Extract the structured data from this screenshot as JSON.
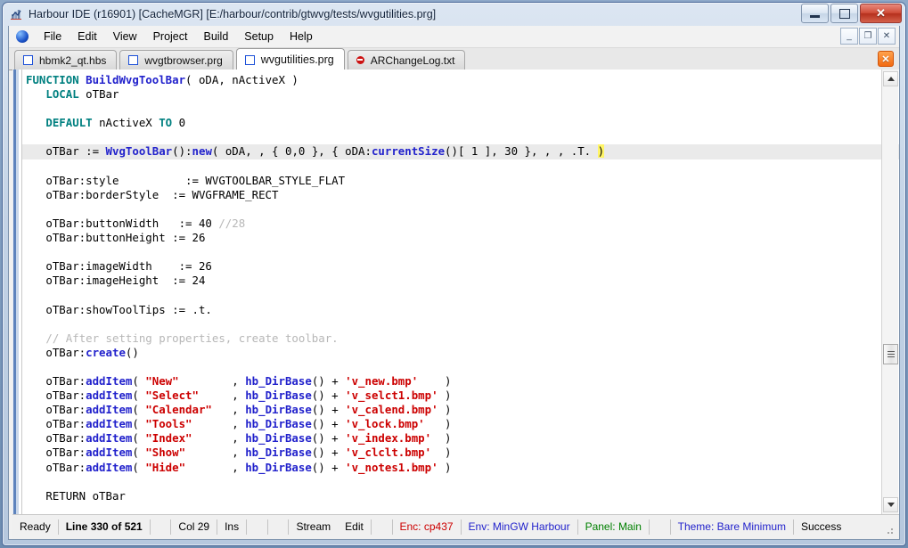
{
  "window": {
    "title": "Harbour IDE (r16901) [CacheMGR]  [E:/harbour/contrib/gtwvg/tests/wvgutilities.prg]",
    "app_icon": "chart-icon",
    "buttons": {
      "minimize": "minimize-icon",
      "maximize": "maximize-icon",
      "close": "✕"
    }
  },
  "menu": {
    "orb": "blue-orb-icon",
    "items": [
      "File",
      "Edit",
      "View",
      "Project",
      "Build",
      "Setup",
      "Help"
    ],
    "mdi_buttons": {
      "minimize": "_",
      "restore": "❐",
      "close": "✕"
    }
  },
  "tabs": {
    "items": [
      {
        "label": "hbmk2_qt.hbs",
        "icon": "file-icon",
        "active": false
      },
      {
        "label": "wvgtbrowser.prg",
        "icon": "file-icon",
        "active": false
      },
      {
        "label": "wvgutilities.prg",
        "icon": "file-icon",
        "active": true
      },
      {
        "label": "ARChangeLog.txt",
        "icon": "stop-icon",
        "active": false
      }
    ],
    "close_label": "✕"
  },
  "editor": {
    "current_line_index": 5,
    "lines": [
      [
        {
          "t": "FUNCTION ",
          "c": "k"
        },
        {
          "t": "BuildWvgToolBar",
          "c": "fn"
        },
        {
          "t": "( oDA, nActiveX )",
          "c": "t"
        }
      ],
      [
        {
          "t": "   ",
          "c": "t"
        },
        {
          "t": "LOCAL",
          "c": "k"
        },
        {
          "t": " oTBar",
          "c": "t"
        }
      ],
      [
        {
          "t": "",
          "c": "t"
        }
      ],
      [
        {
          "t": "   ",
          "c": "t"
        },
        {
          "t": "DEFAULT",
          "c": "k"
        },
        {
          "t": " nActiveX ",
          "c": "t"
        },
        {
          "t": "TO",
          "c": "k"
        },
        {
          "t": " 0",
          "c": "t"
        }
      ],
      [
        {
          "t": "",
          "c": "t"
        }
      ],
      [
        {
          "t": "   oTBar := ",
          "c": "t"
        },
        {
          "t": "WvgToolBar",
          "c": "fn"
        },
        {
          "t": "():",
          "c": "t"
        },
        {
          "t": "new",
          "c": "fn"
        },
        {
          "t": "( oDA, , { 0,0 }, { oDA:",
          "c": "t"
        },
        {
          "t": "currentSize",
          "c": "fn"
        },
        {
          "t": "()[ 1 ], 30 }, , , .T. ",
          "c": "t"
        },
        {
          "t": ")",
          "c": "brk"
        }
      ],
      [
        {
          "t": "",
          "c": "t"
        }
      ],
      [
        {
          "t": "   oTBar:style          := WVGTOOLBAR_STYLE_FLAT",
          "c": "t"
        }
      ],
      [
        {
          "t": "   oTBar:borderStyle  := WVGFRAME_RECT",
          "c": "t"
        }
      ],
      [
        {
          "t": "",
          "c": "t"
        }
      ],
      [
        {
          "t": "   oTBar:buttonWidth   := 40 ",
          "c": "t"
        },
        {
          "t": "//28",
          "c": "c"
        }
      ],
      [
        {
          "t": "   oTBar:buttonHeight := 26",
          "c": "t"
        }
      ],
      [
        {
          "t": "",
          "c": "t"
        }
      ],
      [
        {
          "t": "   oTBar:imageWidth    := 26",
          "c": "t"
        }
      ],
      [
        {
          "t": "   oTBar:imageHeight  := 24",
          "c": "t"
        }
      ],
      [
        {
          "t": "",
          "c": "t"
        }
      ],
      [
        {
          "t": "   oTBar:showToolTips := .t.",
          "c": "t"
        }
      ],
      [
        {
          "t": "",
          "c": "t"
        }
      ],
      [
        {
          "t": "   ",
          "c": "t"
        },
        {
          "t": "// After setting properties, create toolbar.",
          "c": "c"
        }
      ],
      [
        {
          "t": "   oTBar:",
          "c": "t"
        },
        {
          "t": "create",
          "c": "fn"
        },
        {
          "t": "()",
          "c": "t"
        }
      ],
      [
        {
          "t": "",
          "c": "t"
        }
      ],
      [
        {
          "t": "   oTBar:",
          "c": "t"
        },
        {
          "t": "addItem",
          "c": "fn"
        },
        {
          "t": "( ",
          "c": "t"
        },
        {
          "t": "\"New\"",
          "c": "s"
        },
        {
          "t": "        , ",
          "c": "t"
        },
        {
          "t": "hb_DirBase",
          "c": "fn"
        },
        {
          "t": "() + ",
          "c": "t"
        },
        {
          "t": "'v_new.bmp'",
          "c": "s"
        },
        {
          "t": "    )",
          "c": "t"
        }
      ],
      [
        {
          "t": "   oTBar:",
          "c": "t"
        },
        {
          "t": "addItem",
          "c": "fn"
        },
        {
          "t": "( ",
          "c": "t"
        },
        {
          "t": "\"Select\"",
          "c": "s"
        },
        {
          "t": "     , ",
          "c": "t"
        },
        {
          "t": "hb_DirBase",
          "c": "fn"
        },
        {
          "t": "() + ",
          "c": "t"
        },
        {
          "t": "'v_selct1.bmp'",
          "c": "s"
        },
        {
          "t": " )",
          "c": "t"
        }
      ],
      [
        {
          "t": "   oTBar:",
          "c": "t"
        },
        {
          "t": "addItem",
          "c": "fn"
        },
        {
          "t": "( ",
          "c": "t"
        },
        {
          "t": "\"Calendar\"",
          "c": "s"
        },
        {
          "t": "   , ",
          "c": "t"
        },
        {
          "t": "hb_DirBase",
          "c": "fn"
        },
        {
          "t": "() + ",
          "c": "t"
        },
        {
          "t": "'v_calend.bmp'",
          "c": "s"
        },
        {
          "t": " )",
          "c": "t"
        }
      ],
      [
        {
          "t": "   oTBar:",
          "c": "t"
        },
        {
          "t": "addItem",
          "c": "fn"
        },
        {
          "t": "( ",
          "c": "t"
        },
        {
          "t": "\"Tools\"",
          "c": "s"
        },
        {
          "t": "      , ",
          "c": "t"
        },
        {
          "t": "hb_DirBase",
          "c": "fn"
        },
        {
          "t": "() + ",
          "c": "t"
        },
        {
          "t": "'v_lock.bmp'",
          "c": "s"
        },
        {
          "t": "   )",
          "c": "t"
        }
      ],
      [
        {
          "t": "   oTBar:",
          "c": "t"
        },
        {
          "t": "addItem",
          "c": "fn"
        },
        {
          "t": "( ",
          "c": "t"
        },
        {
          "t": "\"Index\"",
          "c": "s"
        },
        {
          "t": "      , ",
          "c": "t"
        },
        {
          "t": "hb_DirBase",
          "c": "fn"
        },
        {
          "t": "() + ",
          "c": "t"
        },
        {
          "t": "'v_index.bmp'",
          "c": "s"
        },
        {
          "t": "  )",
          "c": "t"
        }
      ],
      [
        {
          "t": "   oTBar:",
          "c": "t"
        },
        {
          "t": "addItem",
          "c": "fn"
        },
        {
          "t": "( ",
          "c": "t"
        },
        {
          "t": "\"Show\"",
          "c": "s"
        },
        {
          "t": "       , ",
          "c": "t"
        },
        {
          "t": "hb_DirBase",
          "c": "fn"
        },
        {
          "t": "() + ",
          "c": "t"
        },
        {
          "t": "'v_clclt.bmp'",
          "c": "s"
        },
        {
          "t": "  )",
          "c": "t"
        }
      ],
      [
        {
          "t": "   oTBar:",
          "c": "t"
        },
        {
          "t": "addItem",
          "c": "fn"
        },
        {
          "t": "( ",
          "c": "t"
        },
        {
          "t": "\"Hide\"",
          "c": "s"
        },
        {
          "t": "       , ",
          "c": "t"
        },
        {
          "t": "hb_DirBase",
          "c": "fn"
        },
        {
          "t": "() + ",
          "c": "t"
        },
        {
          "t": "'v_notes1.bmp'",
          "c": "s"
        },
        {
          "t": " )",
          "c": "t"
        }
      ],
      [
        {
          "t": "",
          "c": "t"
        }
      ],
      [
        {
          "t": "   RETURN oTBar",
          "c": "t"
        }
      ]
    ]
  },
  "scrollbar": {
    "up_arrow": "arrow-up-icon",
    "down_arrow": "arrow-down-icon",
    "thumb": "scrollbar-thumb"
  },
  "statusbar": {
    "items": [
      {
        "label": "Ready",
        "style": "",
        "sep": true
      },
      {
        "label": "Line 330 of 521",
        "style": "b",
        "sep": true
      },
      {
        "label": "",
        "style": "",
        "sep": true
      },
      {
        "label": "Col 29",
        "style": "",
        "sep": true
      },
      {
        "label": "Ins",
        "style": "",
        "sep": true
      },
      {
        "label": "",
        "style": "",
        "sep": true
      },
      {
        "label": "",
        "style": "",
        "sep": true
      },
      {
        "label": "Stream",
        "style": "",
        "sep": false
      },
      {
        "label": "Edit",
        "style": "",
        "sep": true
      },
      {
        "label": "",
        "style": "",
        "sep": true
      },
      {
        "label": "Enc: cp437",
        "style": "red",
        "sep": true
      },
      {
        "label": "Env: MinGW Harbour",
        "style": "blue",
        "sep": true
      },
      {
        "label": "Panel: Main",
        "style": "green",
        "sep": true
      },
      {
        "label": "",
        "style": "",
        "sep": true
      },
      {
        "label": "Theme: Bare Minimum",
        "style": "blue",
        "sep": true
      },
      {
        "label": "Success",
        "style": "",
        "sep": false
      }
    ]
  },
  "colors": {
    "keyword": "#008080",
    "function": "#2222cc",
    "string": "#cc0000",
    "comment": "#b7b7b7",
    "current_line": "#eaeaea",
    "bracket_match": "#fff566",
    "titlebar_frame": "#4a6898"
  }
}
